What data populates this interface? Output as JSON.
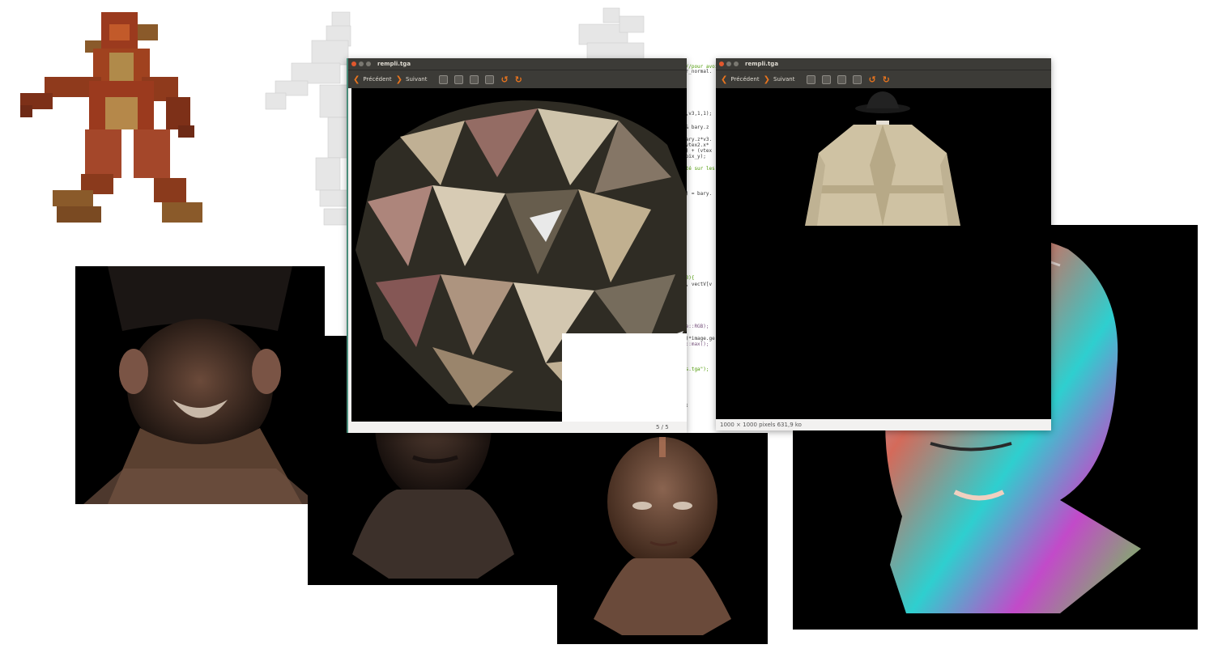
{
  "window_left": {
    "title": "rempli.tga",
    "prev_label": "Précédent",
    "next_label": "Suivant",
    "page_counter": "5 / 5"
  },
  "window_right": {
    "title": "rempli.tga",
    "prev_label": "Précédent",
    "next_label": "Suivant",
    "status": "1000 × 1000 pixels  631,9 ko"
  },
  "code_fragments": [
    "}//pour avoi",
    "ur_normal.",
    "2,v3,1,1);",
    "&& bary.z",
    "bary.z*v3.",
    "(vtex2.x*",
    "x) + (vtex",
    ",pix_y);",
    "ité sur les",
    "]) = bary.",
    "=3){",
    "], vectV[v",
    "ge::RGB);",
    "()*image.ge",
    "e::max();",
    "ss.tga\");",
    ");"
  ],
  "icons": {
    "prev": "chevron-left-icon",
    "next": "chevron-right-icon",
    "rotate_left": "rotate-left-icon",
    "rotate_right": "rotate-right-icon"
  },
  "colors": {
    "titlebar": "#3c3b37",
    "accent": "#e8741e",
    "close": "#e2572d",
    "code_green": "#4e9a06",
    "code_purple": "#75507b"
  }
}
